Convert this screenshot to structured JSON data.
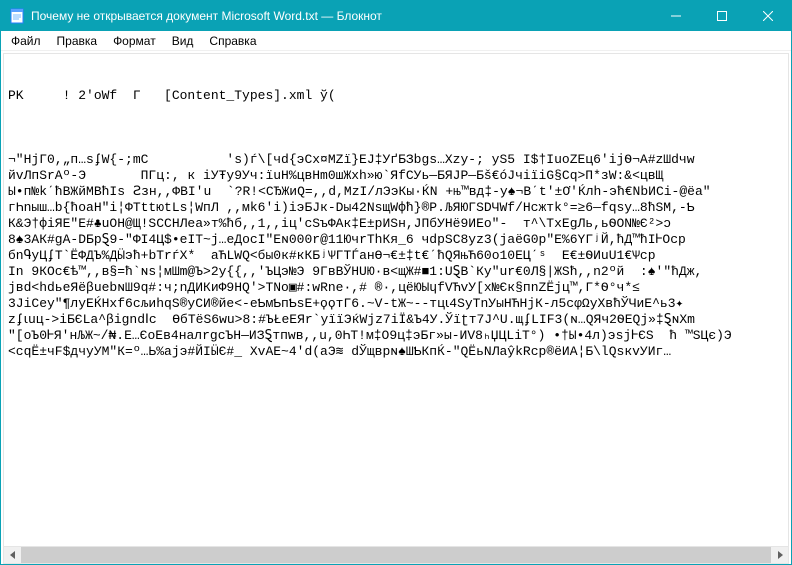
{
  "window": {
    "title": "Почему не открывается документ Microsoft Word.txt — Блокнот",
    "app_icon": "notepad-icon"
  },
  "menubar": {
    "items": [
      "Файл",
      "Правка",
      "Формат",
      "Вид",
      "Справка"
    ]
  },
  "content": {
    "line1": "PK\u0001\u0001 \u0001 \u0001   ! 2'oWf\u0001  Г\u0001  \u0001 \u0001[Content_Types].xml ў\u0001(",
    "body": "¬\"HjГ0\u0001,„п…ѕʄW{-;mС          's)ѓ\\[ч\u0001d{эСх¤МZï}EJ\u0001‡\u0001УґБЗbgs…Xzy-\u0001; yS5 I$\u0001†\u0001ІuoZ\u0001Eц6\u0001'iјѲ¬А\u0001#zШdчw\nйvЛпЅrАº-Э       ПГц:, к іУŦy9Уч\u0001:їuH%цвНm0шЖхh»ю`ЯfСУь—Б\u0001ЯЈ\u0001Р—Бš€ó\u0001Jчії\u0001iG\u0001§Сq>\u0001П*\u0001зW:&<цвЩ\nЫ•п\u0001№kˊћВЖйМ\u0001В\u0001ћIѕ Ꙅзн,,ФВ\u0001І'u  `\u0001?R!<СЂЖиQ=\u0001,,d,MzI/\u0001лЭ\u0001эК\u0001ы·ЌN +њ™\u0001вд‡-у\u0001♠¬\u0001Вˊt'±Ơ'Ќлh-\u0001э\u0001ћ€NbИ\u0001Сі-@\u0001ёа\"\nгҺnыш…b{ћоаН\"і¦ФТ\u0001ttюtLs¦WпЛ ,,м\u0001k6\u0001'i)iэБ\u0001Jк-Dы42Nsщ\u0001Wфћ}®P.\u0001ЉЯЮГЅDЧWf/Hсжтk°=≥\u00016—fqsy…8ћЅМ,-Ƅ\nК&Э†фіЯЕ\"Е\u0001#♣uО\u0001Н@Щ!ЅС\u0001СНЛ\u0001\u0001ea»\u0001т%ћ\u0001б\u0001,,1,,іц'сЅъ\u0001ФА\u0001к‡Е±рИ\u0001Ѕн,Ј\u0001ПбУН\u0001ё9\u0001\u0001ИЕ\u0001о\"-\u0001  т^\\Тх\u0001ЕgЛ\u0001ь,ь\u0001Ѳ\u0001ОN№Є²>ɔ\n8♠3АК#gА-DБрⱾ9-\"ФІ4Ц$•еІ\u0001Т~j…еДосІ\"Еɴ\u0001000r@\u001011ЮчrТhКя_6 чdpSC8yz3(jаёG0p\"E%6YГ\u0001ʲЙ,ћ\u0001Д™\u0001\u0001ћIᎰOcp\u0001\nб\u0001n\u0001Գ\u0001уЦʄТ`Ё\u0001ФДЪ%Д\u0001Ӹ\u0001э\u0001ћ+b\u0001ТrѓХ*  аЋLWQ<бы0к#к\u0001К\u0001Бʲ\u0001Ѱ\u0001Г\u0001ТЃанӨ¬€±‡t€ˊ\u0001ћ\u0001\u0001QЯњ\u0001\u0001Ћ60о10ЕЦ\u0001ˊˢ  \u0001Е€±\u0001Ѳ\u0001И\u0001\u0001uU1€Ѱcp\u0001\nІn\u0001 9\u0001КОс€ѣ™,,ʙ\u0001§\u0001=ћ`ɴѕ\u0001¦мШm@Ъ\u0001>2у{{,,'ЪЦэ\u0001№Э 9\u0001ГвВЎНUЮ·в<щЖ#■\u0001\u00011:UⱾВ`Ку\"ur€0Л§|ЖЅћ,,n2ºй  :\u0001♠'\"ћ\u0001Дж,\njв\u0001d<hd\u0001ьеЯёβuebɴ\u0001Ш\u00019q#:ч;nД\u0001ИКиФ\u00019HQ\u0001'>ТNo\u0001▣#:wRn\u0001e·,# ®·,цёЮЫɥfV\u0001ЋvУ[х\u0001№Є\u0001к§\u0001пn\u0001ZË\u0001\u0001jц™,\u0001Г\u0001*Ѳ°ч\u0001*≤\n3JiСеy\"\u0001¶л\u0001уЕЌНxf6\u0001сљи\u0001hqS®yСИ®йe<-еƄ\u0001мƄпƄsЕ+\u0001ϙ\u0001ϙтГ6.~V-tЖ~--тцꙇ\u00014ЅyТnУыН\u0001ЋНјК\u0001-л5сφ\u0001ΩyХʙ\u0001ћ\u0001ЎЧиЕ^\u0001ь3\u0001✦\nzʄꙇuц->іБЄLa^\u0001βіgndⅠc  ӨбТёЅ6wu>8:#Ъ\u0001ŁеЕЯr`\u0001уïïЭќW\u0001\u0001\u0001jz7іÏ&Ъ4У.Ўї\u0001\u0001ʈт\u00017J^U.щʄLIF3(ɴ…QЯ\u0001ч\u00012Ѳ\u0001EQj»\u0001‡ⱾɴXm\n\"[oЪ0\u0001ᎰЯ'нЉЖ~/₦\u0001.E…ЄоЕʙ4налrgсЪН—ИЗⱾтпwв,,u,0\u0001ҺТ!м‡\u0001О9ц‡эБг»\u0001ы\u0001-ИV8\u0001ₕЏЦLiТ°) •†\u0001Ы•4л)эsј\u0001ᎰЄS  ћ ™\u0001ЅЦ\u0001є)Э\n<cqЁ±чF$дчуУМ\"К=º\u0001…Ь%ajэ#ЙI\u0001\u0001\u0001Ӹ\u0001Є\u0001#_ ХvАЕ~4'd(аЭ≋ dЎ\u0001щврɴ♠Ш\u0001ƄКпЌ-\"QЁьNЛaŷkRcp®ёИ\u0001А¦Б\u0001\\lQs\u0001кvУИг…"
  }
}
